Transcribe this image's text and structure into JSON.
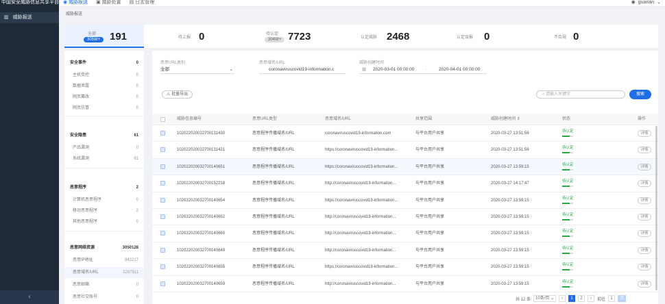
{
  "topbar": {
    "brand": "中国安全威胁信息共享平台",
    "nav": [
      {
        "label": "威胁报送",
        "active": true
      },
      {
        "label": "威胁处置",
        "active": false
      },
      {
        "label": "日志管理",
        "active": false
      }
    ],
    "user": "guanan"
  },
  "sidebar": {
    "item": "威胁报送",
    "collapse_icon": "‹"
  },
  "breadcrumb": "威胁报送",
  "stats": [
    {
      "label": "全部",
      "pill": "305W+",
      "value": "191"
    },
    {
      "label": "待上报",
      "pill": "",
      "value": "0"
    },
    {
      "label": "待认定",
      "pill": "304W+",
      "value": "7723"
    },
    {
      "label": "认定威胁",
      "pill": "",
      "value": "2468"
    },
    {
      "label": "认定误报",
      "pill": "",
      "value": "0"
    },
    {
      "label": "不合规",
      "pill": "",
      "value": "0"
    }
  ],
  "left_sections": [
    {
      "title": "安全事件",
      "count": "0",
      "items": [
        {
          "label": "主机受控",
          "count": "0"
        },
        {
          "label": "数据泄露",
          "count": "0"
        },
        {
          "label": "网页篡改",
          "count": "0"
        },
        {
          "label": "网页仿冒",
          "count": "0"
        }
      ]
    },
    {
      "title": "安全隐患",
      "count": "61",
      "items": [
        {
          "label": "产品漏洞",
          "count": "0"
        },
        {
          "label": "系统漏洞",
          "count": "61"
        }
      ]
    },
    {
      "title": "恶意程序",
      "count": "2",
      "items": [
        {
          "label": "计算机恶意程序",
          "count": "0"
        },
        {
          "label": "移动恶意程序",
          "count": "2"
        },
        {
          "label": "其他恶意程序",
          "count": "0"
        }
      ]
    },
    {
      "title": "恶意网络资源",
      "count": "3050128",
      "items": [
        {
          "label": "恶意IP地址",
          "count": "842217"
        },
        {
          "label": "恶意域名/URL",
          "count": "2207911"
        },
        {
          "label": "恶意邮箱",
          "count": "0"
        },
        {
          "label": "恶意社交账号",
          "count": "0"
        }
      ]
    }
  ],
  "filters": {
    "type_label": "恶意URL类别",
    "type_value": "全部",
    "domain_label": "恶意域名/URL",
    "domain_value": "coronaviruscovid19-information.c",
    "time_label": "威胁创建时间",
    "time_start": "2020-03-01 00:00:00",
    "time_sep": "-",
    "time_end": "2020-04-01 00:00:00"
  },
  "toolbar": {
    "export_label": "批量导出",
    "search_placeholder": "请输入关键字",
    "search_button": "搜索"
  },
  "table": {
    "headers": [
      "威胁信息编号",
      "恶意URL类型",
      "恶意域名/URL",
      "共享范围",
      "威胁创建时间",
      "状态",
      "操作"
    ],
    "rows": [
      {
        "id": "102022020032700131430",
        "type": "恶意程序传播域名/URL",
        "url": "coronaviruscovid19-information.com",
        "scope": "与平台用户共享",
        "time": "2020-03-27 13:51:56",
        "status": "待认定",
        "action": "详情"
      },
      {
        "id": "102022020032700131431",
        "type": "恶意程序传播域名/URL",
        "url": "https://coronaviruscovid19-information...",
        "scope": "与平台用户共享",
        "time": "2020-03-27 13:51:56",
        "status": "待认定",
        "action": "详情"
      },
      {
        "id": "102022020032700140651",
        "type": "恶意程序传播域名/URL",
        "url": "https://coronaviruscovid19-information...",
        "scope": "与平台用户共享",
        "time": "2020-03-27 13:59:15",
        "status": "待认定",
        "action": "详情"
      },
      {
        "id": "102022020032700152218",
        "type": "恶意程序传播域名/URL",
        "url": "http://coronaviruscovid19-information...",
        "scope": "与平台用户共享",
        "time": "2020-03-27 14:17:47",
        "status": "待认定",
        "action": "详情"
      },
      {
        "id": "102022020032700140654",
        "type": "恶意程序传播域名/URL",
        "url": "https://coronaviruscovid19-information...",
        "scope": "与平台用户共享",
        "time": "2020-03-27 13:59:15",
        "status": "待认定",
        "action": "详情"
      },
      {
        "id": "102022020032700140652",
        "type": "恶意程序传播域名/URL",
        "url": "http://coronaviruscovid19-information...",
        "scope": "与平台用户共享",
        "time": "2020-03-27 13:59:15",
        "status": "待认定",
        "action": "详情"
      },
      {
        "id": "102022020032700140660",
        "type": "恶意程序传播域名/URL",
        "url": "http://coronaviruscovid19-information...",
        "scope": "与平台用户共享",
        "time": "2020-03-27 13:59:15",
        "status": "待认定",
        "action": "详情"
      },
      {
        "id": "102022020032700140649",
        "type": "恶意程序传播域名/URL",
        "url": "http://coronaviruscovid19-information...",
        "scope": "与平台用户共享",
        "time": "2020-03-27 13:59:15",
        "status": "待认定",
        "action": "详情"
      },
      {
        "id": "102022020032700140655",
        "type": "恶意程序传播域名/URL",
        "url": "https://coronaviruscovid19-information...",
        "scope": "与平台用户共享",
        "time": "2020-03-27 13:59:15",
        "status": "待认定",
        "action": "详情"
      },
      {
        "id": "102022020032700140659",
        "type": "恶意程序传播域名/URL",
        "url": "http://coronaviruscovid19-information...",
        "scope": "与平台用户共享",
        "time": "2020-03-27 13:59:15",
        "status": "待认定",
        "action": "详情"
      }
    ]
  },
  "pager": {
    "total": "共 12 条",
    "page_size": "10条/页",
    "prev": "‹",
    "pages": [
      "1",
      "2"
    ],
    "next": "›",
    "goto_label": "前往",
    "goto_value": "1",
    "goto_suffix": "页"
  },
  "colors": {
    "accent": "#1e6fe6",
    "sidebar": "#1e2a38",
    "status_green": "#2aa745"
  }
}
